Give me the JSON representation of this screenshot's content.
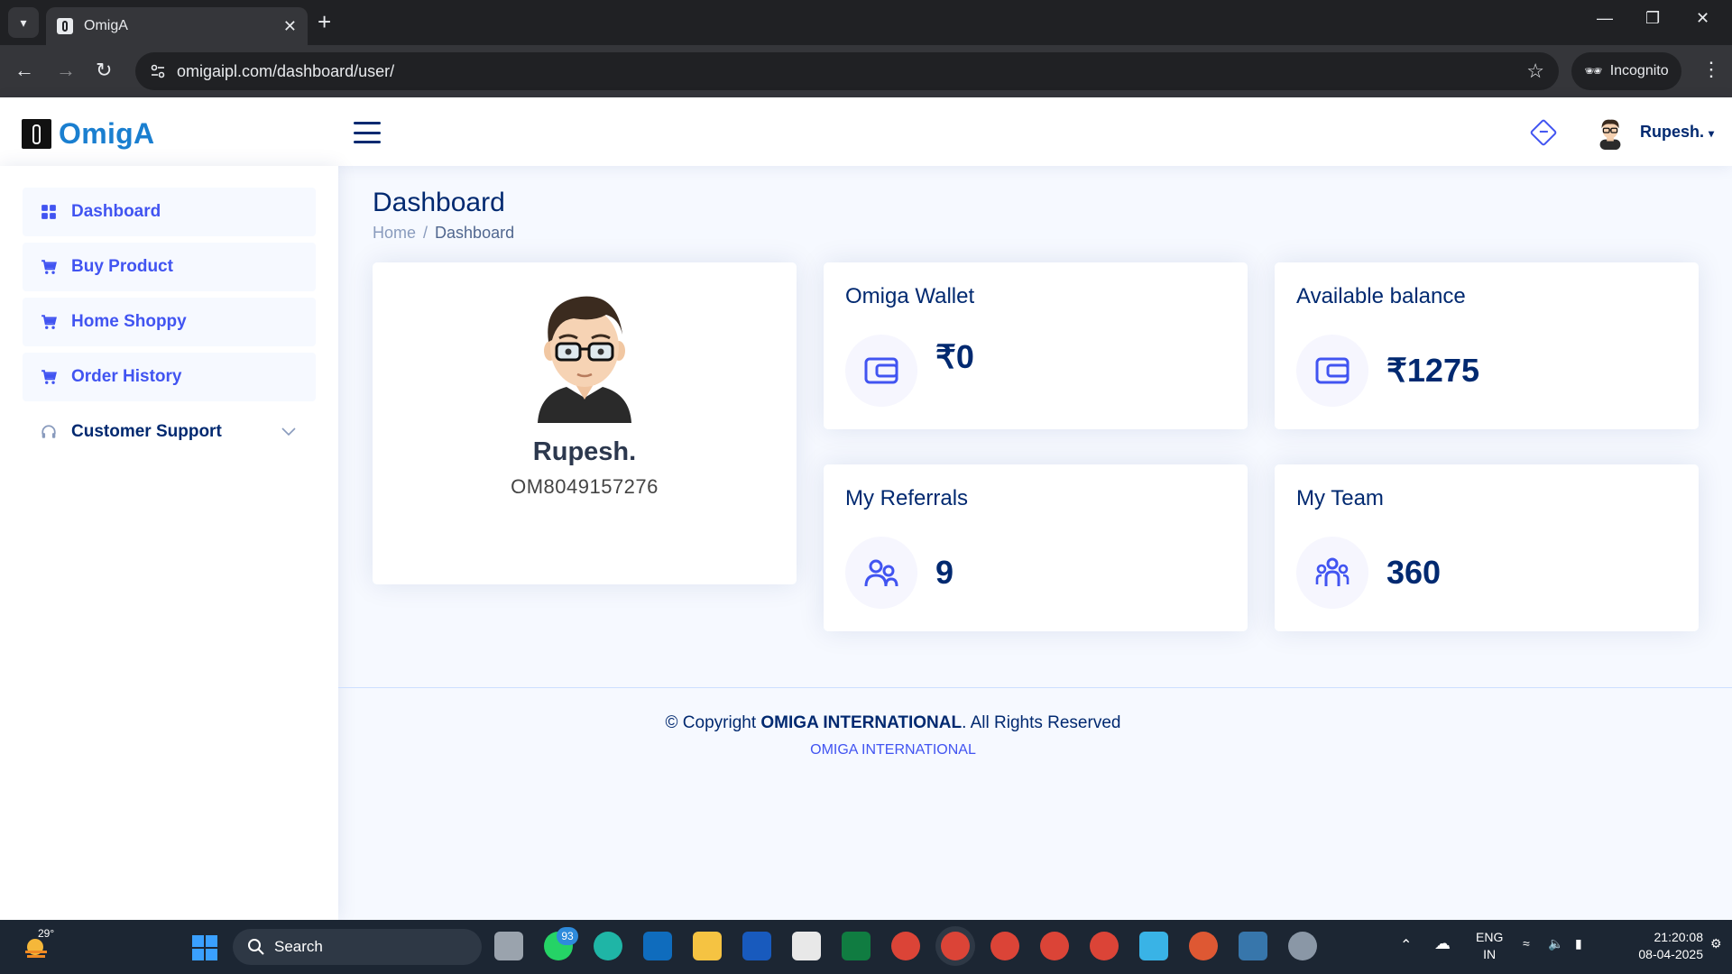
{
  "browser": {
    "tab_title": "OmigA",
    "url": "omigaipl.com/dashboard/user/",
    "incognito_label": "Incognito"
  },
  "header": {
    "logo_text": "OmigA",
    "user_name": "Rupesh."
  },
  "sidebar": {
    "items": [
      {
        "label": "Dashboard",
        "icon": "grid-icon"
      },
      {
        "label": "Buy Product",
        "icon": "cart-icon"
      },
      {
        "label": "Home Shoppy",
        "icon": "cart-icon"
      },
      {
        "label": "Order History",
        "icon": "cart-icon"
      },
      {
        "label": "Customer Support",
        "icon": "headset-icon"
      }
    ]
  },
  "main": {
    "page_title": "Dashboard",
    "breadcrumb": [
      "Home",
      "Dashboard"
    ],
    "profile": {
      "name": "Rupesh.",
      "member_id": "OM8049157276"
    },
    "cards": [
      {
        "title": "Omiga Wallet",
        "value": "₹0",
        "icon": "wallet-icon"
      },
      {
        "title": "Available balance",
        "value": "₹1275",
        "icon": "wallet-icon"
      },
      {
        "title": "My Referrals",
        "value": "9",
        "icon": "people-icon"
      },
      {
        "title": "My Team",
        "value": "360",
        "icon": "team-icon"
      }
    ]
  },
  "footer": {
    "copyright_prefix": "© Copyright ",
    "company": "OMIGA INTERNATIONAL",
    "copyright_suffix": ". All Rights Reserved",
    "credit": "OMIGA INTERNATIONAL"
  },
  "taskbar": {
    "temperature": "29°",
    "search_label": "Search",
    "whatsapp_badge": "93",
    "language": "ENG",
    "region": "IN",
    "time": "21:20:08",
    "date": "08-04-2025"
  },
  "colors": {
    "primary": "#4154f1",
    "navy": "#012970",
    "background": "#f6f9ff",
    "logo_blue": "#1a7fd0"
  }
}
